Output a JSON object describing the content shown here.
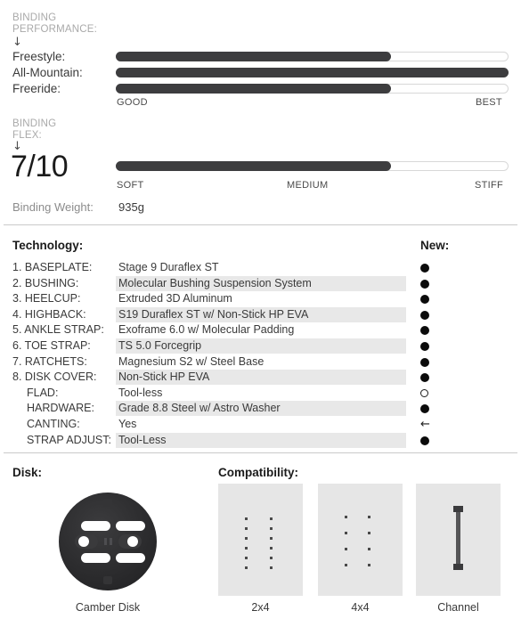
{
  "performance": {
    "heading": "BINDING\nPERFORMANCE:",
    "arrow": "↓",
    "scale_left": "GOOD",
    "scale_right": "BEST",
    "rows": [
      {
        "label": "Freestyle:",
        "percent": 70
      },
      {
        "label": "All-Mountain:",
        "percent": 100
      },
      {
        "label": "Freeride:",
        "percent": 70
      }
    ]
  },
  "flex": {
    "heading": "BINDING\nFLEX:",
    "arrow": "↓",
    "value": "7/10",
    "percent": 70,
    "scale_left": "SOFT",
    "scale_mid": "MEDIUM",
    "scale_right": "STIFF"
  },
  "weight": {
    "label": "Binding Weight:",
    "value": "935g"
  },
  "technology": {
    "title": "Technology:",
    "new_title": "New:",
    "rows": [
      {
        "key": "1. BASEPLATE:",
        "value": "Stage 9 Duraflex ST",
        "mark": "filled",
        "band": false,
        "indent": false
      },
      {
        "key": "2. BUSHING:",
        "value": "Molecular Bushing Suspension System",
        "mark": "filled",
        "band": true,
        "indent": false
      },
      {
        "key": "3. HEELCUP:",
        "value": "Extruded 3D Aluminum",
        "mark": "filled",
        "band": false,
        "indent": false
      },
      {
        "key": "4. HIGHBACK:",
        "value": "S19 Duraflex ST w/ Non-Stick HP EVA",
        "mark": "filled",
        "band": true,
        "indent": false
      },
      {
        "key": "5. ANKLE STRAP:",
        "value": "Exoframe 6.0 w/ Molecular Padding",
        "mark": "filled",
        "band": false,
        "indent": false
      },
      {
        "key": "6. TOE STRAP:",
        "value": "TS 5.0 Forcegrip",
        "mark": "filled",
        "band": true,
        "indent": false
      },
      {
        "key": "7. RATCHETS:",
        "value": "Magnesium S2 w/ Steel Base",
        "mark": "filled",
        "band": false,
        "indent": false
      },
      {
        "key": "8. DISK COVER:",
        "value": "Non-Stick HP EVA",
        "mark": "filled",
        "band": true,
        "indent": false
      },
      {
        "key": "FLAD:",
        "value": "Tool-less",
        "mark": "open",
        "band": false,
        "indent": true
      },
      {
        "key": "HARDWARE:",
        "value": "Grade 8.8 Steel w/ Astro Washer",
        "mark": "filled",
        "band": true,
        "indent": true
      },
      {
        "key": "CANTING:",
        "value": "Yes",
        "mark": "arrow",
        "band": false,
        "indent": true
      },
      {
        "key": "STRAP ADJUST:",
        "value": "Tool-Less",
        "mark": "filled",
        "band": true,
        "indent": true
      }
    ]
  },
  "disk": {
    "title": "Disk:",
    "caption": "Camber Disk"
  },
  "compatibility": {
    "title": "Compatibility:",
    "items": [
      {
        "caption": "2x4",
        "pattern": "2x4"
      },
      {
        "caption": "4x4",
        "pattern": "4x4"
      },
      {
        "caption": "Channel",
        "pattern": "channel"
      }
    ]
  },
  "colors": {
    "fill": "#3d3d3f",
    "band": "#e8e8e8",
    "muted": "#a9a9a9"
  }
}
